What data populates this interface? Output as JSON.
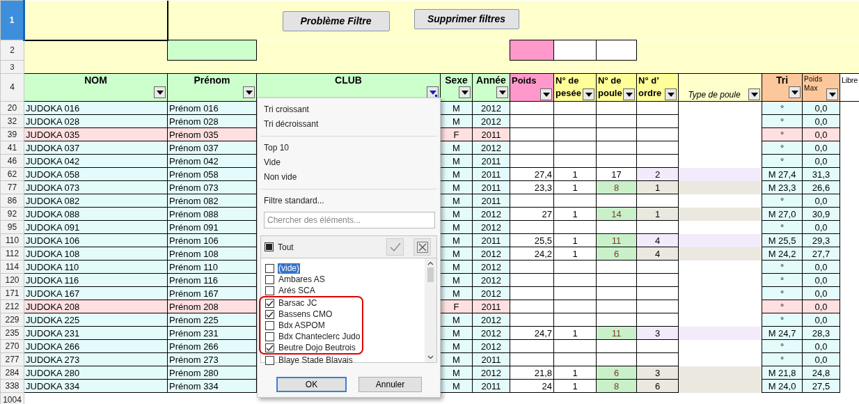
{
  "sheet": {
    "row_headers": [
      {
        "label": "1",
        "selected": true
      },
      {
        "label": "2",
        "selected": false
      },
      {
        "label": "3",
        "selected": false
      },
      {
        "label": "4",
        "selected": false
      }
    ],
    "buttons": [
      {
        "label": "Problème Filtre"
      },
      {
        "label": "Supprimer filtres"
      }
    ],
    "row_2_cells": {
      "prenom": {
        "color": "#ccffcc"
      },
      "poids": {
        "color": "#ff99cc"
      },
      "pesee": {
        "color": "#ffffff"
      },
      "poule": {
        "color": "#ffffff"
      }
    },
    "columns": [
      {
        "label": "NOM",
        "color": "#ccffcc",
        "kind": "title",
        "filter": true,
        "filter_active": false
      },
      {
        "label": "Prénom",
        "color": "#ccffcc",
        "kind": "title",
        "filter": true,
        "filter_active": false
      },
      {
        "label": "CLUB",
        "color": "#ccffcc",
        "kind": "title",
        "filter": true,
        "filter_active": true
      },
      {
        "label": "Sexe",
        "color": "#ccffcc",
        "kind": "title",
        "filter": true,
        "filter_active": false
      },
      {
        "label": "Année",
        "color": "#ccffcc",
        "kind": "title",
        "filter": true,
        "filter_active": false
      },
      {
        "label": "Poids",
        "color": "#ff99cc",
        "kind": "wrap",
        "filter": true,
        "filter_active": false
      },
      {
        "label": "N° de pesée",
        "color": "#ffff99",
        "kind": "wrap",
        "filter": true,
        "filter_active": false
      },
      {
        "label": "N° de poule",
        "color": "#ffff99",
        "kind": "wrap",
        "filter": true,
        "filter_active": false
      },
      {
        "label": "N° d’ ordre",
        "color": "#ffff99",
        "kind": "wrap",
        "filter": true,
        "filter_active": false
      },
      {
        "label": "Type de poule",
        "color": "#ffffcc",
        "kind": "note",
        "filter": true,
        "filter_active": false
      },
      {
        "label": "Tri",
        "color": "#fcc89b",
        "kind": "title",
        "filter": true,
        "filter_active": false
      },
      {
        "label": "Poids Max",
        "color": "#fcc89b",
        "kind": "small",
        "filter": true,
        "filter_active": false
      },
      {
        "label": "Libre",
        "color": "#ffffff",
        "kind": "plain",
        "filter": false
      }
    ],
    "rows": [
      {
        "row": "20",
        "selected": false,
        "highlighted": false,
        "nom": "JUDOKA 016",
        "prenom": "Prénom 016",
        "sexe": "M",
        "annee": "2012",
        "tri": "°",
        "pmax": "0,0"
      },
      {
        "row": "32",
        "selected": false,
        "highlighted": false,
        "nom": "JUDOKA 028",
        "prenom": "Prénom 028",
        "sexe": "M",
        "annee": "2012",
        "tri": "°",
        "pmax": "0,0"
      },
      {
        "row": "39",
        "selected": false,
        "highlighted": true,
        "nom": "JUDOKA 035",
        "prenom": "Prénom 035",
        "sexe": "F",
        "annee": "2011",
        "tri": "°",
        "pmax": "0,0"
      },
      {
        "row": "41",
        "selected": false,
        "highlighted": false,
        "nom": "JUDOKA 037",
        "prenom": "Prénom 037",
        "sexe": "M",
        "annee": "2012",
        "tri": "°",
        "pmax": "0,0"
      },
      {
        "row": "46",
        "selected": false,
        "highlighted": false,
        "nom": "JUDOKA 042",
        "prenom": "Prénom 042",
        "sexe": "M",
        "annee": "2011",
        "tri": "°",
        "pmax": "0,0"
      },
      {
        "row": "62",
        "selected": false,
        "highlighted": false,
        "nom": "JUDOKA 058",
        "prenom": "Prénom 058",
        "sexe": "M",
        "annee": "2011",
        "poids": "27,4",
        "pesee": "1",
        "poule": "17",
        "poule_marked": false,
        "ordre": "2",
        "color": "#f3eafc",
        "tri": "M 27,4",
        "pmax": "31,3"
      },
      {
        "row": "77",
        "selected": false,
        "highlighted": false,
        "nom": "JUDOKA 073",
        "prenom": "Prénom 073",
        "sexe": "M",
        "annee": "2011",
        "poids": "23,3",
        "pesee": "1",
        "poule": "8",
        "poule_marked": true,
        "ordre": "1",
        "color": "#ebe8df",
        "tri": "M 23,3",
        "pmax": "26,6"
      },
      {
        "row": "86",
        "selected": false,
        "highlighted": false,
        "nom": "JUDOKA 082",
        "prenom": "Prénom 082",
        "sexe": "M",
        "annee": "2011",
        "tri": "°",
        "pmax": "0,0"
      },
      {
        "row": "92",
        "selected": false,
        "highlighted": false,
        "nom": "JUDOKA 088",
        "prenom": "Prénom 088",
        "sexe": "M",
        "annee": "2012",
        "poids": "27",
        "pesee": "1",
        "poule": "14",
        "poule_marked": true,
        "ordre": "1",
        "color": "#ebe8df",
        "tri": "M 27,0",
        "pmax": "30,9"
      },
      {
        "row": "95",
        "selected": false,
        "highlighted": false,
        "nom": "JUDOKA 091",
        "prenom": "Prénom 091",
        "sexe": "M",
        "annee": "2012",
        "tri": "°",
        "pmax": "0,0"
      },
      {
        "row": "110",
        "selected": false,
        "highlighted": false,
        "nom": "JUDOKA 106",
        "prenom": "Prénom 106",
        "sexe": "M",
        "annee": "2011",
        "poids": "25,5",
        "pesee": "1",
        "poule": "11",
        "poule_marked": true,
        "ordre": "4",
        "color": "#f3eafc",
        "tri": "M 25,5",
        "pmax": "29,3"
      },
      {
        "row": "112",
        "selected": false,
        "highlighted": false,
        "nom": "JUDOKA 108",
        "prenom": "Prénom 108",
        "sexe": "M",
        "annee": "2012",
        "poids": "24,2",
        "pesee": "1",
        "poule": "6",
        "poule_marked": true,
        "ordre": "4",
        "color": "#ebe8df",
        "tri": "M 24,2",
        "pmax": "27,7"
      },
      {
        "row": "114",
        "selected": false,
        "highlighted": false,
        "nom": "JUDOKA 110",
        "prenom": "Prénom 110",
        "sexe": "M",
        "annee": "2012",
        "tri": "°",
        "pmax": "0,0"
      },
      {
        "row": "120",
        "selected": false,
        "highlighted": false,
        "nom": "JUDOKA 116",
        "prenom": "Prénom 116",
        "sexe": "M",
        "annee": "2012",
        "tri": "°",
        "pmax": "0,0"
      },
      {
        "row": "171",
        "selected": false,
        "highlighted": false,
        "nom": "JUDOKA 167",
        "prenom": "Prénom 167",
        "sexe": "M",
        "annee": "2012",
        "tri": "°",
        "pmax": "0,0"
      },
      {
        "row": "212",
        "selected": false,
        "highlighted": true,
        "nom": "JUDOKA 208",
        "prenom": "Prénom 208",
        "sexe": "F",
        "annee": "2011",
        "tri": "°",
        "pmax": "0,0"
      },
      {
        "row": "229",
        "selected": false,
        "highlighted": false,
        "nom": "JUDOKA 225",
        "prenom": "Prénom 225",
        "sexe": "M",
        "annee": "2012",
        "tri": "°",
        "pmax": "0,0"
      },
      {
        "row": "235",
        "selected": false,
        "highlighted": false,
        "nom": "JUDOKA 231",
        "prenom": "Prénom 231",
        "sexe": "M",
        "annee": "2012",
        "poids": "24,7",
        "pesee": "1",
        "poule": "11",
        "poule_marked": true,
        "ordre": "3",
        "color": "#f3eafc",
        "tri": "M 24,7",
        "pmax": "28,3"
      },
      {
        "row": "270",
        "selected": false,
        "highlighted": false,
        "nom": "JUDOKA 266",
        "prenom": "Prénom 266",
        "sexe": "M",
        "annee": "2012",
        "tri": "°",
        "pmax": "0,0"
      },
      {
        "row": "277",
        "selected": false,
        "highlighted": false,
        "nom": "JUDOKA 273",
        "prenom": "Prénom 273",
        "sexe": "M",
        "annee": "2011",
        "tri": "°",
        "pmax": "0,0"
      },
      {
        "row": "284",
        "selected": false,
        "highlighted": false,
        "nom": "JUDOKA 280",
        "prenom": "Prénom 280",
        "sexe": "M",
        "annee": "2012",
        "poids": "21,8",
        "pesee": "1",
        "poule": "6",
        "poule_marked": true,
        "ordre": "3",
        "color": "#ebe8df",
        "tri": "M 21,8",
        "pmax": "24,8"
      },
      {
        "row": "338",
        "selected": false,
        "highlighted": false,
        "nom": "JUDOKA 334",
        "prenom": "Prénom 334",
        "sexe": "M",
        "annee": "2011",
        "poids": "24",
        "pesee": "1",
        "poule": "8",
        "poule_marked": true,
        "ordre": "6",
        "color": "#ebe8df",
        "tri": "M 24,0",
        "pmax": "27,5"
      }
    ],
    "bottom_row_headers": [
      {
        "label": "1004",
        "selected": false
      }
    ]
  },
  "filter_popup": {
    "menu_groups": [
      [
        {
          "label": "Tri croissant"
        },
        {
          "label": "Tri décroissant"
        }
      ],
      [
        {
          "label": "Top 10"
        },
        {
          "label": "Vide"
        },
        {
          "label": "Non vide"
        }
      ],
      [
        {
          "label": "Filtre standard..."
        }
      ]
    ],
    "search": {
      "placeholder": "Chercher des éléments..."
    },
    "all": {
      "label": "Tout",
      "checked": false,
      "partial": true
    },
    "values": [
      {
        "label": "(vide)",
        "checked": false,
        "selected": true,
        "outlined": false
      },
      {
        "label": "Ambares AS",
        "checked": false,
        "selected": false,
        "outlined": false
      },
      {
        "label": "Arés SCA",
        "checked": false,
        "selected": false,
        "outlined": false
      },
      {
        "label": "Barsac JC",
        "checked": true,
        "selected": false,
        "outlined": true
      },
      {
        "label": "Bassens CMO",
        "checked": true,
        "selected": false,
        "outlined": true
      },
      {
        "label": "Bdx ASPOM",
        "checked": false,
        "selected": false,
        "outlined": true
      },
      {
        "label": "Bdx Chanteclerc Judo",
        "checked": false,
        "selected": false,
        "outlined": true
      },
      {
        "label": "Beutre Dojo Beutrois",
        "checked": true,
        "selected": false,
        "outlined": true
      },
      {
        "label": "Blaye Stade Blavais",
        "checked": false,
        "selected": false,
        "outlined": false
      }
    ],
    "buttons": [
      {
        "label": "OK",
        "kind": "default"
      },
      {
        "label": "Annuler",
        "kind": "normal"
      }
    ]
  }
}
